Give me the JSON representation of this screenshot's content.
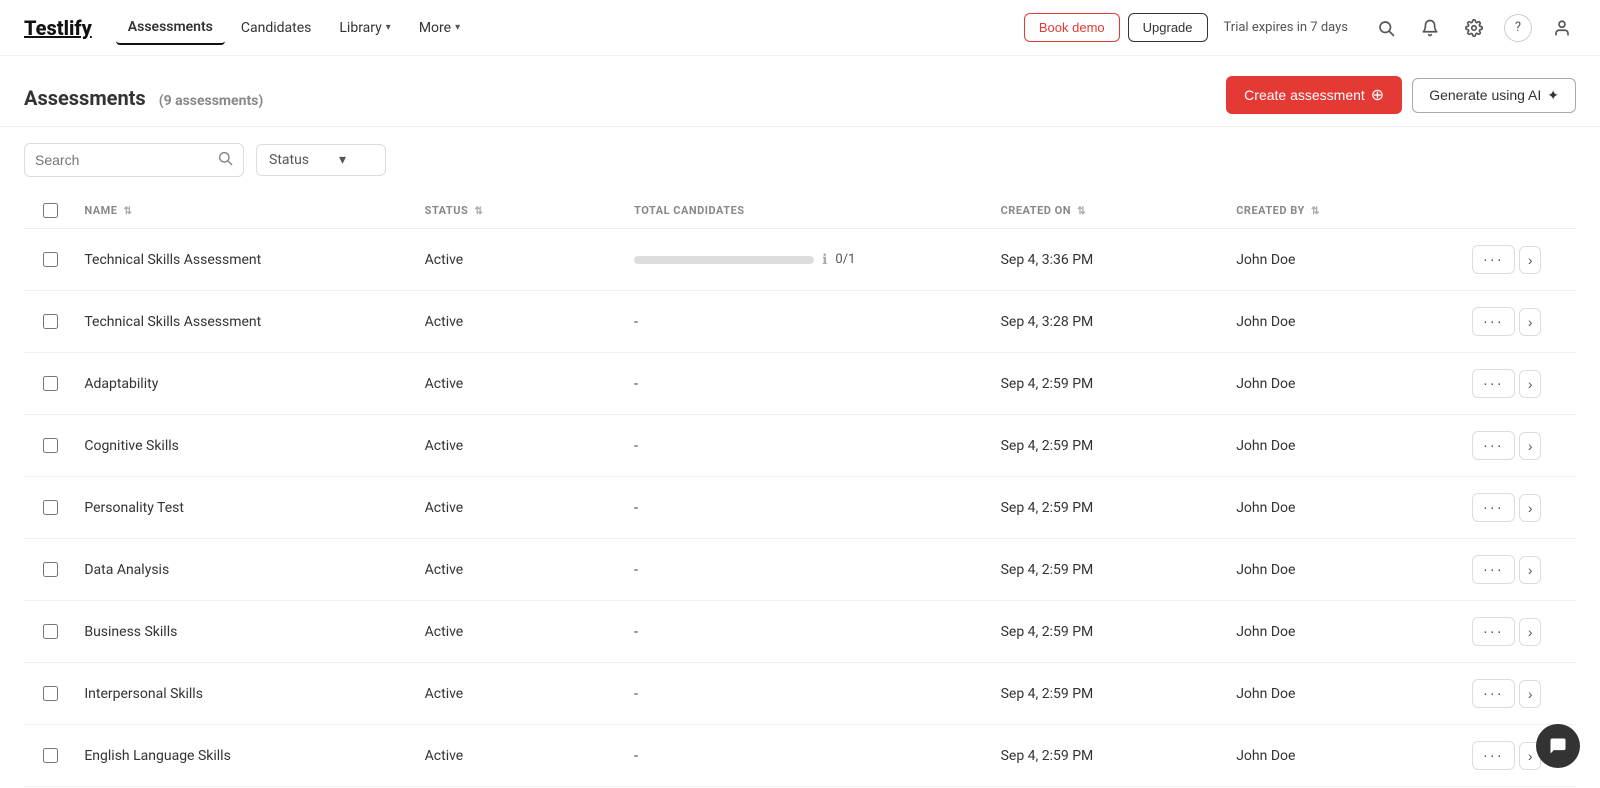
{
  "brand": {
    "logo": "Testlify"
  },
  "navbar": {
    "items": [
      {
        "label": "Assessments",
        "active": true,
        "hasDropdown": false
      },
      {
        "label": "Candidates",
        "active": false,
        "hasDropdown": false
      },
      {
        "label": "Library",
        "active": false,
        "hasDropdown": true
      },
      {
        "label": "More",
        "active": false,
        "hasDropdown": true
      }
    ],
    "bookDemo": "Book demo",
    "upgrade": "Upgrade",
    "trialBadge": "Trial expires in 7 days"
  },
  "pageHeader": {
    "title": "Assessments",
    "count": "(9 assessments)",
    "createBtn": "Create assessment",
    "generateBtn": "Generate using AI"
  },
  "filters": {
    "searchPlaceholder": "Search",
    "statusLabel": "Status"
  },
  "table": {
    "columns": [
      {
        "label": "NAME",
        "sortable": true
      },
      {
        "label": "STATUS",
        "sortable": true
      },
      {
        "label": "TOTAL CANDIDATES",
        "sortable": false
      },
      {
        "label": "CREATED ON",
        "sortable": true
      },
      {
        "label": "CREATED BY",
        "sortable": true
      }
    ],
    "rows": [
      {
        "name": "Technical Skills Assessment",
        "status": "Active",
        "candidates": "0/1",
        "hasProgress": true,
        "createdOn": "Sep 4, 3:36 PM",
        "createdBy": "John Doe"
      },
      {
        "name": "Technical Skills Assessment",
        "status": "Active",
        "candidates": "-",
        "hasProgress": false,
        "createdOn": "Sep 4, 3:28 PM",
        "createdBy": "John Doe"
      },
      {
        "name": "Adaptability",
        "status": "Active",
        "candidates": "-",
        "hasProgress": false,
        "createdOn": "Sep 4, 2:59 PM",
        "createdBy": "John Doe"
      },
      {
        "name": "Cognitive Skills",
        "status": "Active",
        "candidates": "-",
        "hasProgress": false,
        "createdOn": "Sep 4, 2:59 PM",
        "createdBy": "John Doe"
      },
      {
        "name": "Personality Test",
        "status": "Active",
        "candidates": "-",
        "hasProgress": false,
        "createdOn": "Sep 4, 2:59 PM",
        "createdBy": "John Doe"
      },
      {
        "name": "Data Analysis",
        "status": "Active",
        "candidates": "-",
        "hasProgress": false,
        "createdOn": "Sep 4, 2:59 PM",
        "createdBy": "John Doe"
      },
      {
        "name": "Business Skills",
        "status": "Active",
        "candidates": "-",
        "hasProgress": false,
        "createdOn": "Sep 4, 2:59 PM",
        "createdBy": "John Doe"
      },
      {
        "name": "Interpersonal Skills",
        "status": "Active",
        "candidates": "-",
        "hasProgress": false,
        "createdOn": "Sep 4, 2:59 PM",
        "createdBy": "John Doe"
      },
      {
        "name": "English Language Skills",
        "status": "Active",
        "candidates": "-",
        "hasProgress": false,
        "createdOn": "Sep 4, 2:59 PM",
        "createdBy": "John Doe"
      }
    ]
  }
}
